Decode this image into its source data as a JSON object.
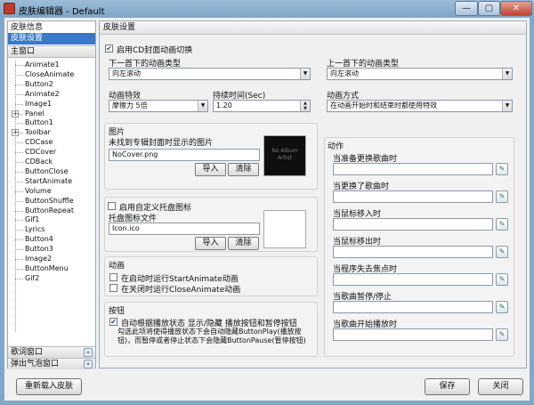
{
  "window": {
    "title": "皮肤编辑器 - Default",
    "min_glyph": "—",
    "max_glyph": "▢",
    "close_glyph": "✕"
  },
  "sidebar": {
    "category_skin_info": "皮肤信息",
    "category_skin_settings": "皮肤设置",
    "category_main": "主窗口",
    "tree_items": [
      "Animate1",
      "CloseAnimate",
      "Button2",
      "Animate2",
      "Image1",
      "Panel",
      "Button1",
      "Toolbar",
      "CDCase",
      "CDCover",
      "CDBack",
      "ButtonClose",
      "StartAnimate",
      "Volume",
      "ButtonShuffle",
      "ButtonRepeat",
      "Gif1",
      "Lyrics",
      "Button4",
      "Button3",
      "Image2",
      "ButtonMenu",
      "Gif2"
    ],
    "expandable": [
      "Panel",
      "Toolbar"
    ],
    "category_lyrics": "歌词窗口",
    "category_bubble": "弹出气泡窗口",
    "chevron_glyph": "»"
  },
  "pane": {
    "header": "皮肤设置",
    "cd_switch": {
      "checked": true,
      "label": "启用CD封面动画切换"
    },
    "next_anim_label": "下一首下的动画类型",
    "next_anim_value": "向左滚动",
    "prev_anim_label": "上一首下的动画类型",
    "prev_anim_value": "向左滚动",
    "effect_label": "动画特效",
    "effect_value": "摩擦力 5倍",
    "duration_label": "持续时间(Sec)",
    "duration_value": "1.20",
    "mode_label": "动画方式",
    "mode_value": "在动画开始时和结束时都使用特效",
    "picture": {
      "title": "图片",
      "desc": "未找到专辑封面时显示的图片",
      "file": "NoCover.png",
      "import_label": "导入",
      "clear_label": "清除",
      "preview_text": "No Album Artist"
    },
    "tray": {
      "checked": false,
      "label": "启用自定义托盘图标",
      "file_label": "托盘图标文件",
      "file": "Icon.ico",
      "import_label": "导入",
      "clear_label": "清除"
    },
    "animation": {
      "title": "动画",
      "start_label": "在启动时运行StartAnimate动画",
      "start_checked": false,
      "close_label": "在关闭时运行CloseAnimate动画",
      "close_checked": false
    },
    "buttons": {
      "title": "按钮",
      "auto_label": "自动根据播放状态 显示/隐藏 播放按钮和暂停按钮",
      "auto_checked": true,
      "desc": "勾选此项将使得播放状态下会自动隐藏ButtonPlay(播放按钮)，而暂停或者停止状态下会隐藏ButtonPause(暂停按钮)"
    },
    "actions": {
      "title": "动作",
      "items": [
        "当准备更换歌曲时",
        "当更换了歌曲时",
        "当鼠标移入时",
        "当鼠标移出时",
        "当程序失去焦点时",
        "当歌曲暂停/停止",
        "当歌曲开始播放时"
      ]
    }
  },
  "footer": {
    "reload_label": "重新载入皮肤",
    "save_label": "保存",
    "close_label": "关闭"
  },
  "check_glyph": "✔",
  "arrow_glyph": "▼"
}
